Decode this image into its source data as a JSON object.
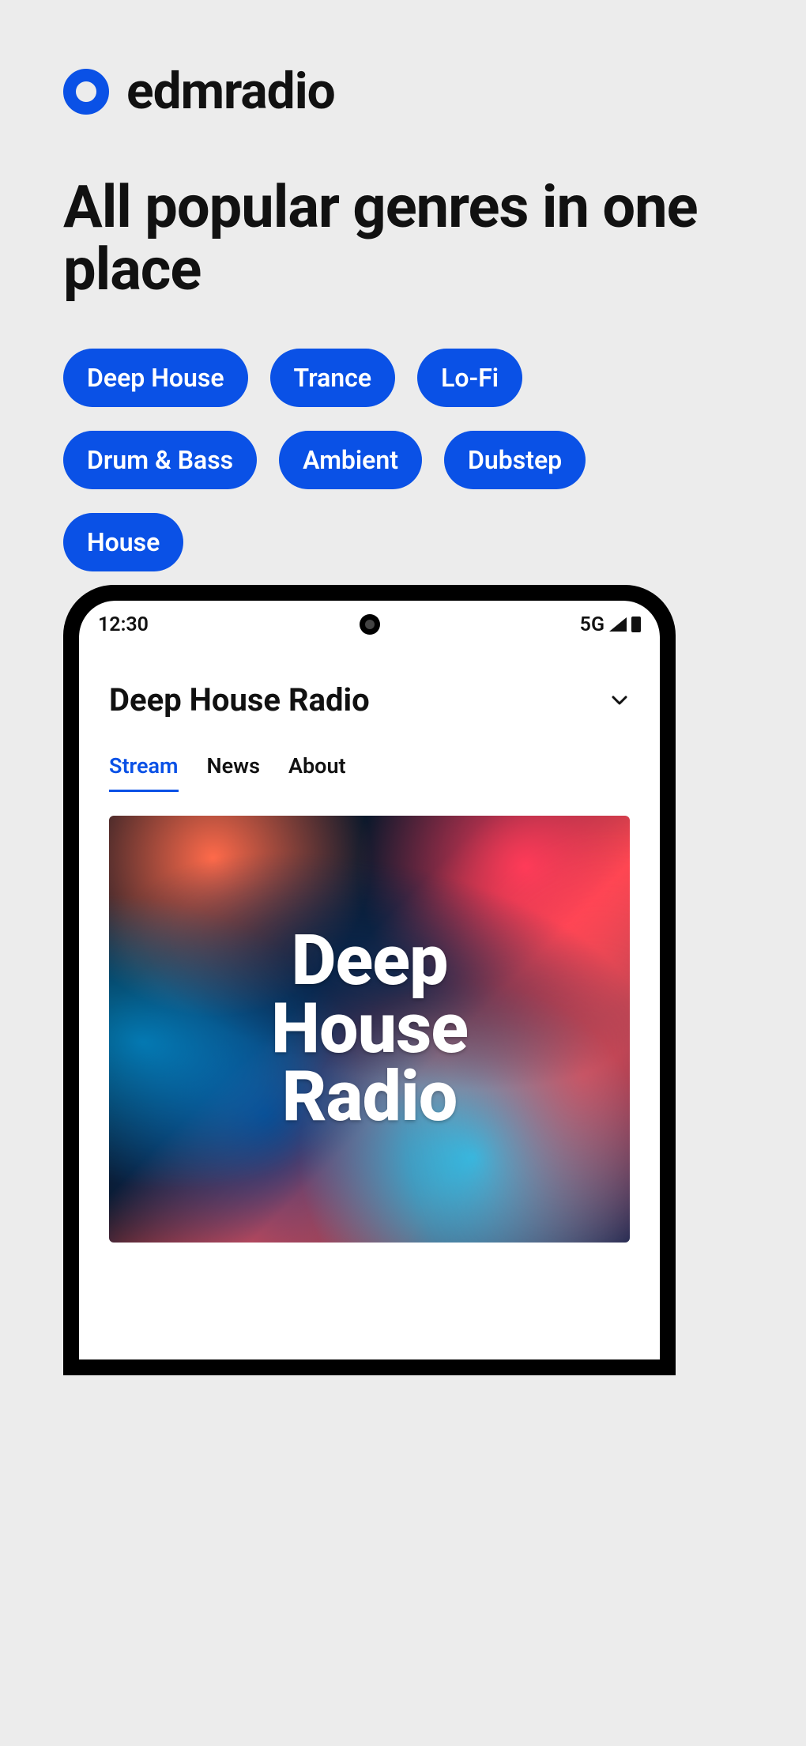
{
  "brand": {
    "name": "edmradio"
  },
  "headline": "All popular genres in one place",
  "genres": [
    "Deep House",
    "Trance",
    "Lo-Fi",
    "Drum & Bass",
    "Ambient",
    "Dubstep",
    "House"
  ],
  "phone": {
    "status": {
      "time": "12:30",
      "network": "5G"
    },
    "header": {
      "title": "Deep House Radio"
    },
    "tabs": [
      {
        "label": "Stream",
        "active": true
      },
      {
        "label": "News",
        "active": false
      },
      {
        "label": "About",
        "active": false
      }
    ],
    "cover": {
      "line1": "Deep",
      "line2": "House",
      "line3": "Radio"
    }
  }
}
